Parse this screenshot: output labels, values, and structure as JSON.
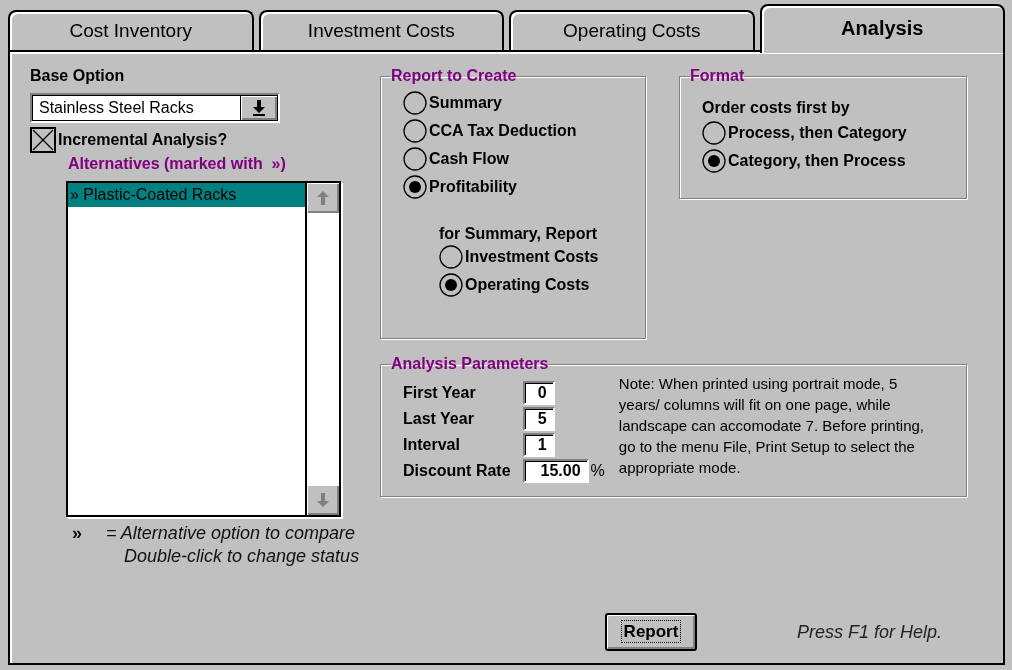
{
  "tabs": [
    {
      "label": "Cost Inventory",
      "selected": false
    },
    {
      "label": "Investment Costs",
      "selected": false
    },
    {
      "label": "Operating Costs",
      "selected": false
    },
    {
      "label": "Analysis",
      "selected": true
    }
  ],
  "base_option": {
    "label": "Base Option",
    "value": "Stainless Steel Racks"
  },
  "incremental": {
    "label": "Incremental Analysis?",
    "checked": true
  },
  "alternatives": {
    "label": "Alternatives (marked with  »)",
    "items": [
      {
        "text": "» Plastic-Coated Racks",
        "selected": true
      }
    ]
  },
  "legend": {
    "symbol": "»",
    "lines": [
      "= Alternative option to compare",
      "Double-click to change status"
    ]
  },
  "report_to_create": {
    "title": "Report to Create",
    "options": [
      {
        "label": "Summary",
        "selected": false
      },
      {
        "label": "CCA Tax Deduction",
        "selected": false
      },
      {
        "label": "Cash Flow",
        "selected": false
      },
      {
        "label": "Profitability",
        "selected": true
      }
    ],
    "summary_label": "for Summary, Report",
    "summary_options": [
      {
        "label": "Investment Costs",
        "selected": false
      },
      {
        "label": "Operating Costs",
        "selected": true
      }
    ]
  },
  "format": {
    "title": "Format",
    "label": "Order costs first by",
    "options": [
      {
        "label": "Process, then Category",
        "selected": false
      },
      {
        "label": "Category, then Process",
        "selected": true
      }
    ]
  },
  "analysis_parameters": {
    "title": "Analysis Parameters",
    "fields": [
      {
        "label": "First Year",
        "value": "0"
      },
      {
        "label": "Last Year",
        "value": "5"
      },
      {
        "label": "Interval",
        "value": "1"
      },
      {
        "label": "Discount Rate",
        "value": "15.00",
        "unit": "%"
      }
    ],
    "note": "Note: When printed using portrait mode, 5 years/ columns will fit on one page, while landscape can accomodate 7.  Before printing, go to the menu File, Print Setup to select the appropriate mode."
  },
  "report_button": "Report",
  "help": "Press F1 for Help."
}
